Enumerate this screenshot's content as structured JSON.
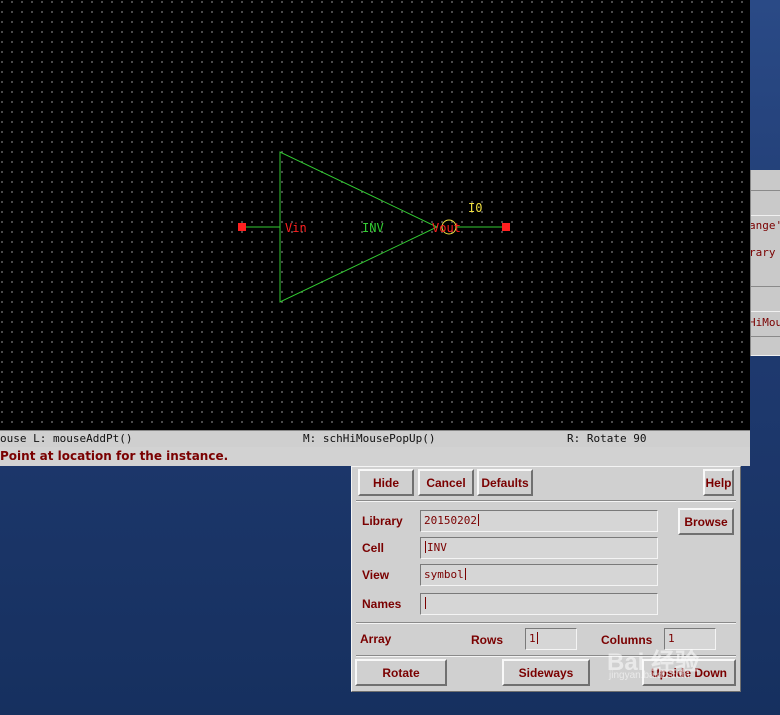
{
  "schematic": {
    "pins": {
      "input": "Vin",
      "output": "Vout"
    },
    "cell_label": "INV",
    "instance_name": "I0",
    "colors": {
      "symbol_line": "#33cc33",
      "pin_text": "#ff2020",
      "instance_text": "#f0e040",
      "cell_text": "#33cc33",
      "pin_square": "#ff2020"
    }
  },
  "mouse_bindings": {
    "left": "ouse L: mouseAddPt()",
    "middle": "M: schHiMousePopUp()",
    "right": "R: Rotate 90"
  },
  "prompt": "Point at location for the instance.",
  "side_window": {
    "line1": "ange'",
    "line2": "rary",
    "line3": "HiMou"
  },
  "form": {
    "buttons": {
      "hide": "Hide",
      "cancel": "Cancel",
      "defaults": "Defaults",
      "help": "Help",
      "browse": "Browse",
      "rotate": "Rotate",
      "sideways": "Sideways",
      "upside_down": "Upside Down"
    },
    "labels": {
      "library": "Library",
      "cell": "Cell",
      "view": "View",
      "names": "Names",
      "array": "Array",
      "rows": "Rows",
      "columns": "Columns"
    },
    "values": {
      "library": "20150202",
      "cell": "INV",
      "view": "symbol",
      "names": "",
      "rows": "1",
      "columns": "1"
    }
  },
  "watermark": {
    "text": "Bai 经验",
    "sub": "jingyan.baidu.com"
  }
}
